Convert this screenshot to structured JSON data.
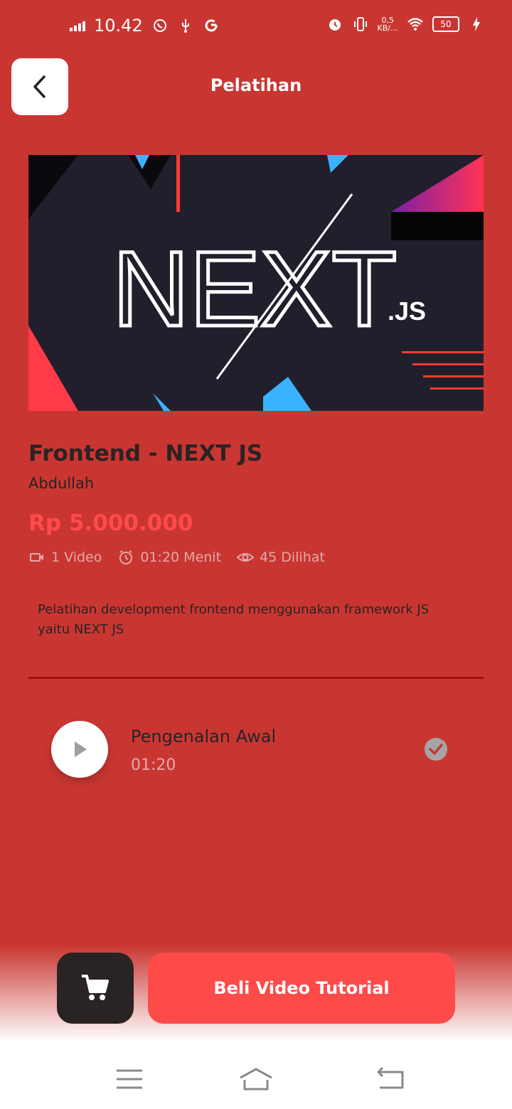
{
  "status_bar": {
    "time": "10.42",
    "net_speed_value": "0,5",
    "net_speed_unit": "KB/…",
    "battery": "50",
    "icons": [
      "signal-icon",
      "whatsapp-icon",
      "usb-icon",
      "google-icon",
      "alarm-icon",
      "vibrate-icon",
      "wifi-icon",
      "battery-icon",
      "charging-icon"
    ]
  },
  "header": {
    "title": "Pelatihan",
    "back_icon": "chevron-left-icon"
  },
  "banner": {
    "logo_text": "NEXT",
    "logo_suffix": ".JS"
  },
  "course": {
    "title": "Frontend - NEXT JS",
    "author": "Abdullah",
    "price": "Rp 5.000.000",
    "videos": "1 Video",
    "duration": "01:20 Menit",
    "views": "45 Dilihat",
    "description": "Pelatihan development frontend menggunakan framework JS yaitu NEXT JS"
  },
  "videos": [
    {
      "title": "Pengenalan Awal",
      "duration": "01:20"
    }
  ],
  "actions": {
    "buy_label": "Beli Video Tutorial",
    "cart_icon": "cart-icon"
  },
  "colors": {
    "background": "#c93632",
    "accent": "#ff4a4a",
    "dark": "#2a2323",
    "muted": "#e3a9a6",
    "divider": "#a0100d"
  }
}
